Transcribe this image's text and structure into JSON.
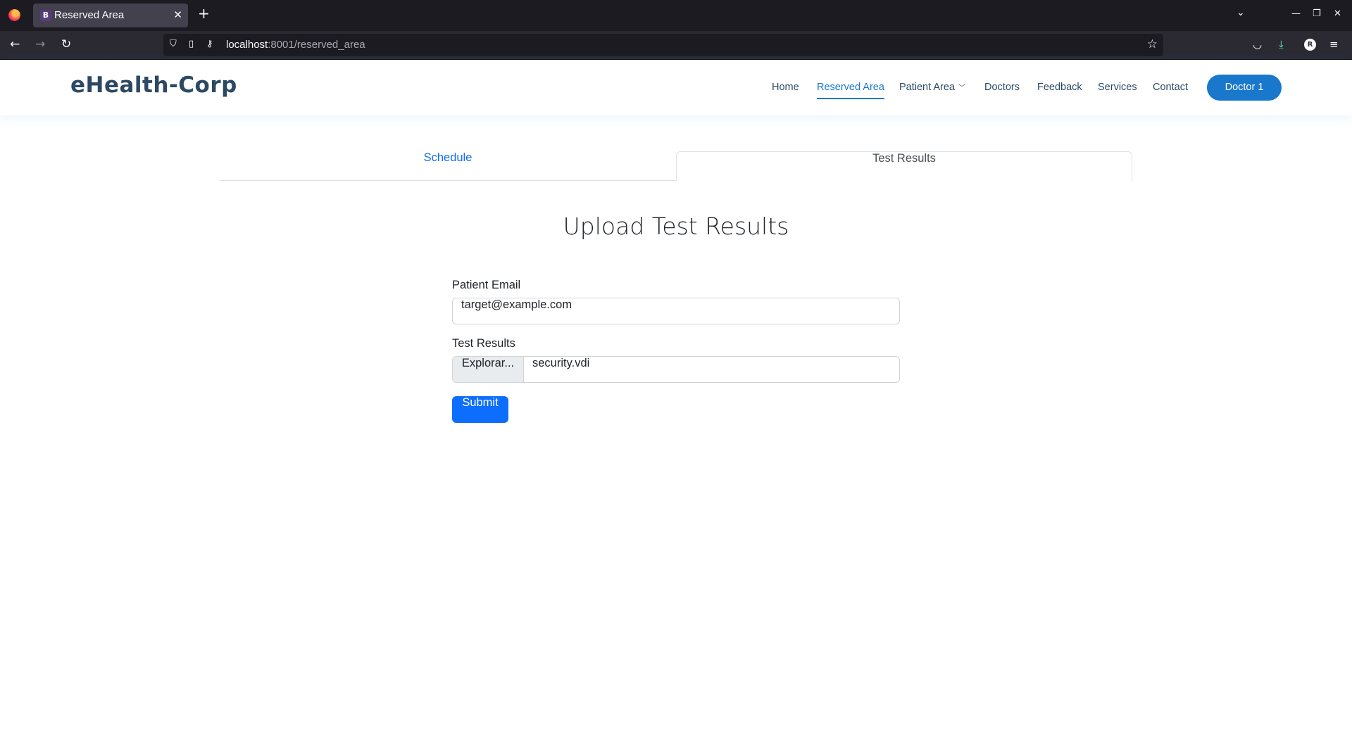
{
  "browser": {
    "tab_title": "Reserved Area",
    "tab_favicon_letter": "B",
    "url_host": "localhost",
    "url_path": ":8001/reserved_area",
    "account_initial": "R"
  },
  "site": {
    "logo": "eHealth-Corp",
    "nav": [
      "Home",
      "Reserved Area",
      "Patient Area",
      "Doctors",
      "Feedback",
      "Services",
      "Contact"
    ],
    "active_nav": "Reserved Area",
    "user_button": "Doctor 1"
  },
  "tabs": {
    "schedule": "Schedule",
    "test_results": "Test Results",
    "active": "Test Results"
  },
  "form": {
    "title": "Upload Test Results",
    "email_label": "Patient Email",
    "email_value": "target@example.com",
    "file_label": "Test Results",
    "file_button": "Explorar...",
    "file_name": "security.vdi",
    "submit": "Submit"
  },
  "colors": {
    "accent": "#1977cc",
    "primary": "#0d6efd",
    "heading": "#2c4964"
  }
}
